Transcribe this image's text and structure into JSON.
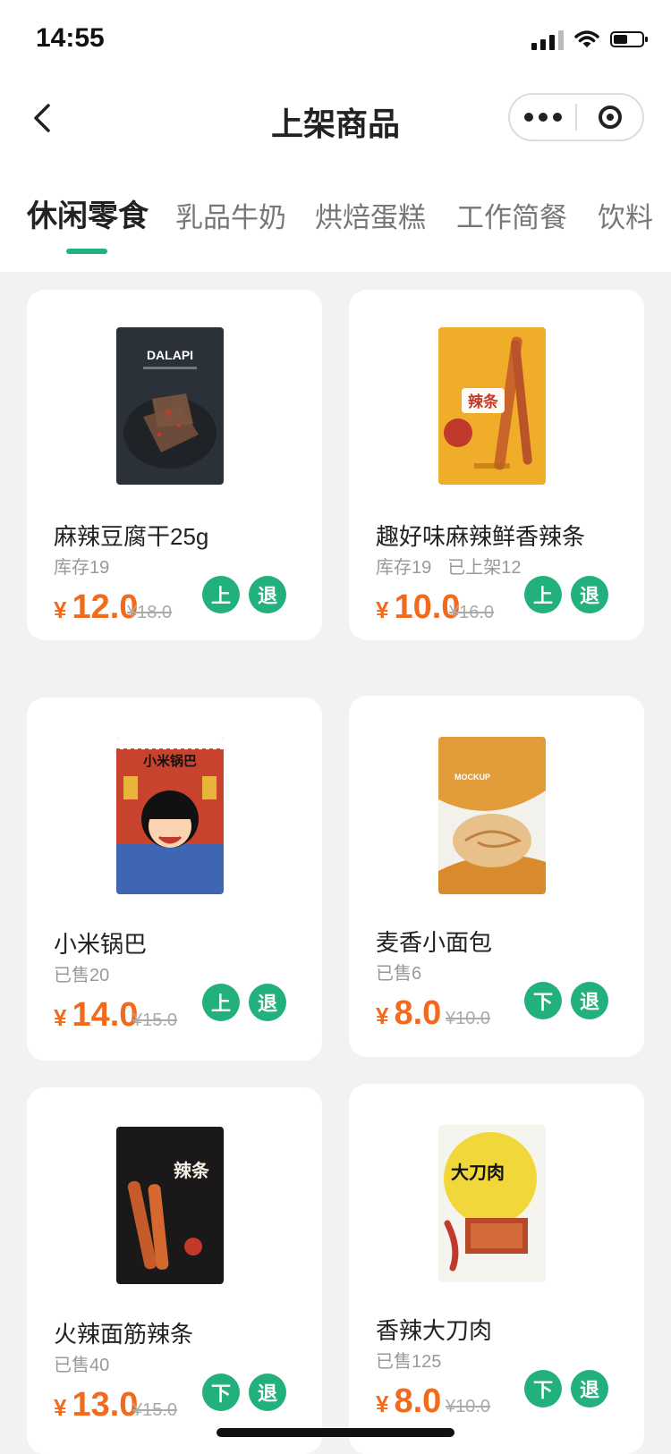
{
  "status_bar": {
    "time": "14:55"
  },
  "navbar": {
    "title": "上架商品"
  },
  "tabs": [
    {
      "label": "休闲零食",
      "active": true
    },
    {
      "label": "乳品牛奶",
      "active": false
    },
    {
      "label": "烘焙蛋糕",
      "active": false
    },
    {
      "label": "工作简餐",
      "active": false
    },
    {
      "label": "饮料",
      "active": false
    }
  ],
  "colors": {
    "accent": "#22b07d",
    "price": "#f26a1b"
  },
  "products": [
    {
      "name": "麻辣豆腐干25g",
      "meta1": "库存19",
      "meta2": "",
      "currency": "¥",
      "price": "12.0",
      "orig": "¥18.0",
      "btn1": "上",
      "btn2": "退",
      "image": "package-dalapi",
      "image_text": "DALAPI"
    },
    {
      "name": "趣好味麻辣鲜香辣条",
      "meta1": "库存19",
      "meta2": "已上架12",
      "currency": "¥",
      "price": "10.0",
      "orig": "¥16.0",
      "btn1": "上",
      "btn2": "退",
      "image": "package-latiao-yellow",
      "image_text": "辣条"
    },
    {
      "name": "小米锅巴",
      "meta1": "已售20",
      "meta2": "",
      "currency": "¥",
      "price": "14.0",
      "orig": "¥15.0",
      "btn1": "上",
      "btn2": "退",
      "image": "package-guoba",
      "image_text": "小米锅巴"
    },
    {
      "name": "麦香小面包",
      "meta1": "已售6",
      "meta2": "",
      "currency": "¥",
      "price": "8.0",
      "orig": "¥10.0",
      "btn1": "下",
      "btn2": "退",
      "image": "package-bread",
      "image_text": "MOCKUP"
    },
    {
      "name": "火辣面筋辣条",
      "meta1": "已售40",
      "meta2": "",
      "currency": "¥",
      "price": "13.0",
      "orig": "¥15.0",
      "btn1": "下",
      "btn2": "退",
      "image": "package-latiao-black",
      "image_text": "辣条"
    },
    {
      "name": "香辣大刀肉",
      "meta1": "已售125",
      "meta2": "",
      "currency": "¥",
      "price": "8.0",
      "orig": "¥10.0",
      "btn1": "下",
      "btn2": "退",
      "image": "package-dadaorou",
      "image_text": "大刀肉"
    }
  ]
}
